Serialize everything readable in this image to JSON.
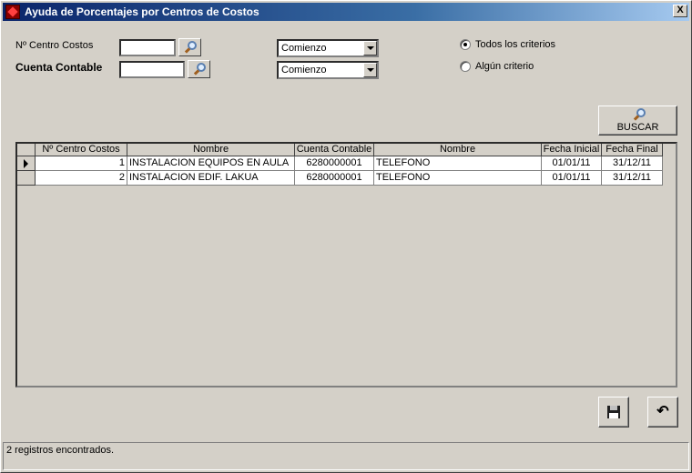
{
  "window": {
    "title": "Ayuda de Porcentajes por Centros de Costos",
    "close_label": "X"
  },
  "filters": {
    "centro_label": "Nº Centro Costos",
    "centro_value": "",
    "centro_match": "Comienzo",
    "cuenta_label": "Cuenta Contable",
    "cuenta_value": "",
    "cuenta_match": "Comienzo"
  },
  "criteria": {
    "all_label": "Todos los criterios",
    "any_label": "Algún criterio",
    "selected": "all"
  },
  "buscar_label": "BUSCAR",
  "grid": {
    "columns": [
      "Nº Centro Costos",
      "Nombre",
      "Cuenta Contable",
      "Nombre",
      "Fecha Inicial",
      "Fecha Final"
    ],
    "rows": [
      [
        "1",
        "INSTALACION EQUIPOS EN AULA",
        "6280000001",
        "TELEFONO",
        "01/01/11",
        "31/12/11"
      ],
      [
        "2",
        "INSTALACION EDIF. LAKUA",
        "6280000001",
        "TELEFONO",
        "01/01/11",
        "31/12/11"
      ]
    ],
    "current_row": 0
  },
  "icons": {
    "search": "magnifier-icon",
    "save": "floppy-disk-icon",
    "undo": "undo-arrow-icon"
  },
  "status": {
    "text": "2 registros encontrados."
  }
}
